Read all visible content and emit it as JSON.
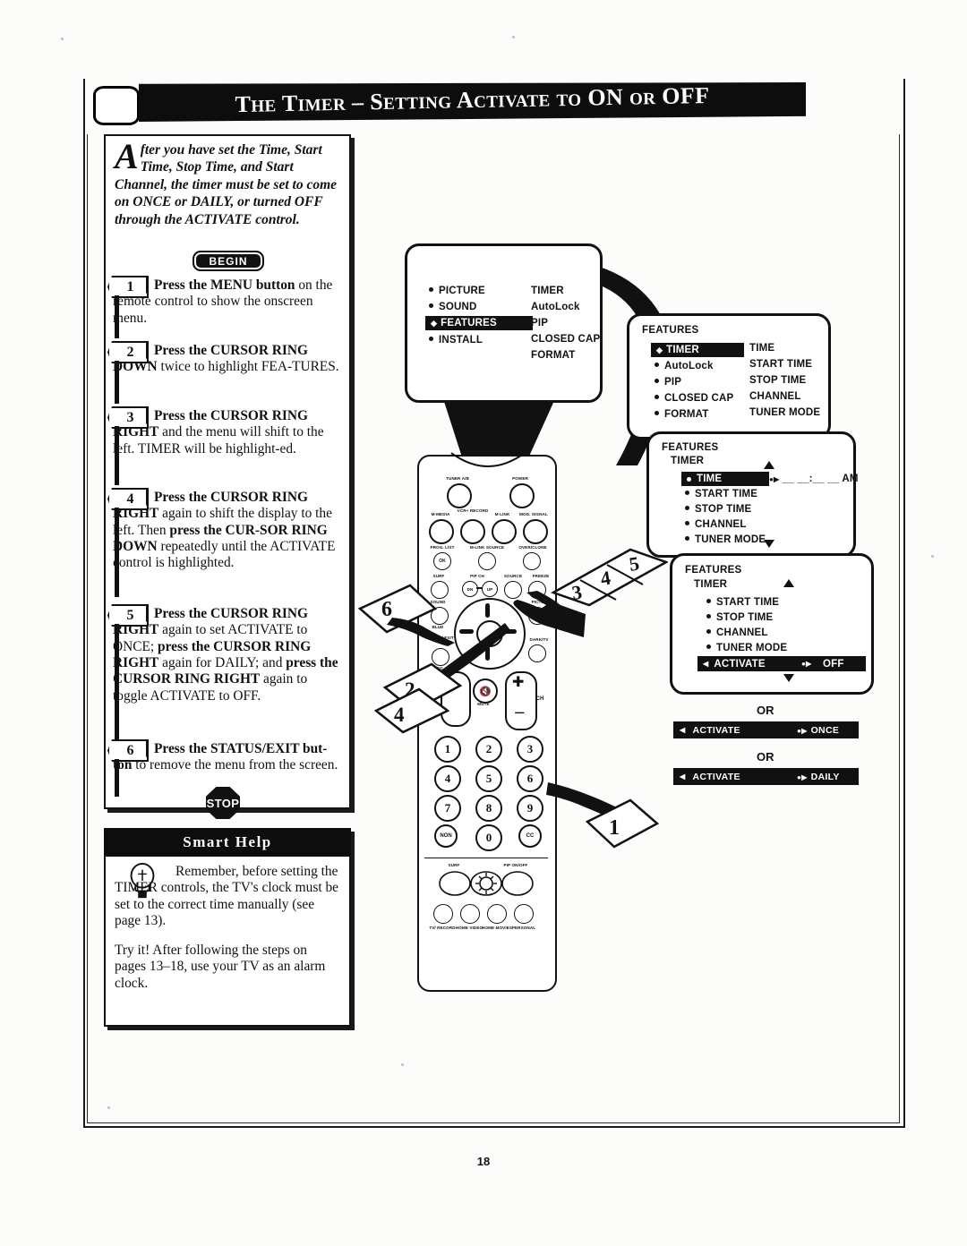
{
  "header": {
    "title_parts": [
      "The Timer",
      "–",
      "Setting Activate to ",
      "On",
      " or ",
      "Off"
    ],
    "title_full": "THE TIMER – SETTING ACTIVATE TO ON OR OFF",
    "tv_icon": "tv-screen-icon"
  },
  "intro": {
    "dropcap": "A",
    "text": "fter you have set the Time, Start Time, Stop Time, and Start Channel, the timer must be set to come on ONCE or DAILY,  or turned OFF through the ACTIVATE control.",
    "begin_label": "BEGIN"
  },
  "steps": [
    {
      "num": "1",
      "html": "<b>Press the MENU button</b> on the remote control to show the onscreen menu."
    },
    {
      "num": "2",
      "html": "<b>Press the CURSOR RING DOWN</b> twice to highlight FEA-TURES."
    },
    {
      "num": "3",
      "html": "<b>Press the CURSOR RING RIGHT</b> and the menu will shift to the left. TIMER will be highlight-ed."
    },
    {
      "num": "4",
      "html": "<b>Press the CURSOR RING RIGHT</b> again to shift the display to the left. Then <b>press the CUR-SOR RING DOWN</b> repeatedly until the ACTIVATE control is highlighted."
    },
    {
      "num": "5",
      "html": "<b>Press the CURSOR RING RIGHT</b> again to set ACTIVATE to ONCE; <b>press the CURSOR RING RIGHT</b> again for DAILY; and <b>press the CURSOR RING RIGHT</b> again to toggle ACTIVATE to OFF."
    },
    {
      "num": "6",
      "html": "<b>Press the STATUS/EXIT but-ton</b> to remove the menu from the screen."
    }
  ],
  "stop_label": "STOP",
  "smart_help": {
    "title": "Smart Help",
    "icon": "lightbulb-icon",
    "paragraph1": "Remember, before setting the TIMER controls, the TV's clock must be set to the correct time manually (see page 13).",
    "paragraph2": "Try it! After following the steps on pages 13–18, use your TV as an alarm clock."
  },
  "screens": [
    {
      "id": "main-menu",
      "title": "",
      "left_items": [
        "PICTURE",
        "SOUND",
        "FEATURES",
        "INSTALL"
      ],
      "highlighted": "FEATURES",
      "right_items": [
        "TIMER",
        "AutoLock",
        "PIP",
        "CLOSED CAP",
        "FORMAT"
      ]
    },
    {
      "id": "features-menu",
      "title": "FEATURES",
      "left_items": [
        "TIMER",
        "AutoLock",
        "PIP",
        "CLOSED CAP",
        "FORMAT"
      ],
      "highlighted": "TIMER",
      "right_items": [
        "TIME",
        "START TIME",
        "STOP TIME",
        "CHANNEL",
        "TUNER MODE"
      ]
    },
    {
      "id": "timer-menu",
      "title": "FEATURES",
      "subtitle": "TIMER",
      "left_items": [
        "TIME",
        "START TIME",
        "STOP TIME",
        "CHANNEL",
        "TUNER MODE"
      ],
      "highlighted": "TIME",
      "value": "__ __:__ __ AM"
    },
    {
      "id": "activate-menu",
      "title": "FEATURES",
      "subtitle": "TIMER",
      "left_items": [
        "START TIME",
        "STOP TIME",
        "CHANNEL",
        "TUNER MODE",
        "ACTIVATE"
      ],
      "highlighted": "ACTIVATE",
      "value": "OFF"
    }
  ],
  "or_options": [
    {
      "or": "OR",
      "label": "ACTIVATE",
      "value": "ONCE"
    },
    {
      "or": "OR",
      "label": "ACTIVATE",
      "value": "DAILY"
    }
  ],
  "remote": {
    "labels_row1": [
      "TUNER A/B",
      "POWER"
    ],
    "labels_row2": [
      "M-MEDIA",
      "VCR+ RECORD",
      "M-LINK",
      "MOD. SIGNAL"
    ],
    "labels_row3": [
      "PROG. LIST",
      "M-LINK SOURCE",
      "OVER/CLONE"
    ],
    "labels_row4": [
      "SURF",
      "PIP CH",
      "SOURCE",
      "FREEZE"
    ],
    "labels_row5": [
      "SOUND",
      "PICTURE"
    ],
    "labels_row6": [
      "STATUS/ EXIT",
      "BLUE",
      "INFO",
      "DARK/TV"
    ],
    "pip_dn": "DN",
    "pip_up": "UP",
    "mute_label": "MUTE",
    "ch_label": "CH",
    "ok_label": "OK",
    "keys": [
      "1",
      "2",
      "3",
      "4",
      "5",
      "6",
      "7",
      "8",
      "9",
      "NON",
      "0",
      "CC"
    ],
    "bottom_labels": [
      "SURF",
      "PIP ON/OFF"
    ],
    "bottom_row": [
      "TV/ RECORD",
      "HOME VIDEO",
      "HOME MOVIES",
      "PERSONAL"
    ]
  },
  "callouts": [
    {
      "num": "1",
      "target": "status-exit-button"
    },
    {
      "num": "2",
      "target": "cursor-ring-down"
    },
    {
      "num": "3",
      "target": "cursor-ring-right"
    },
    {
      "num": "4",
      "target": "cursor-ring-right"
    },
    {
      "num": "5",
      "target": "cursor-ring-right"
    },
    {
      "num": "6",
      "target": "status-exit-button"
    }
  ],
  "page_number": "18"
}
